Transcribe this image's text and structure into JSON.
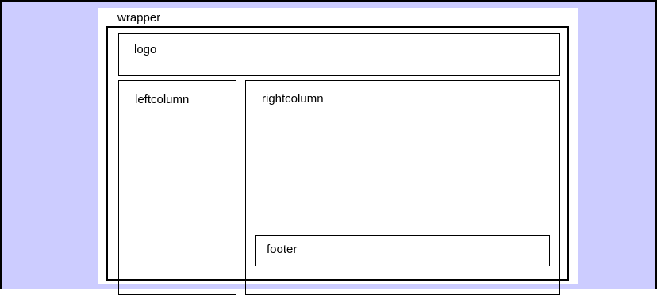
{
  "colors": {
    "canvas_background": "#ccccff",
    "page_background": "#ffffff",
    "border": "#000000"
  },
  "labels": {
    "wrapper": "wrapper",
    "logo": "logo",
    "leftcolumn": "leftcolumn",
    "rightcolumn": "rightcolumn",
    "footer": "footer"
  }
}
